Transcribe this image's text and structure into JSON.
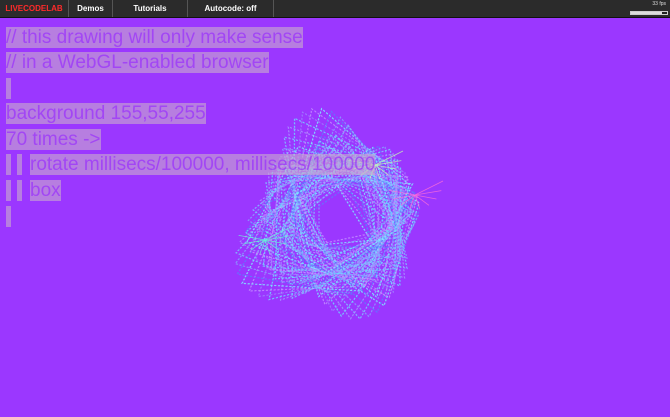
{
  "menu": {
    "logo": "LIVECODELAB",
    "items": [
      {
        "label": "Demos"
      },
      {
        "label": "Tutorials"
      },
      {
        "label": "Autocode: off"
      }
    ],
    "fps": "33 fps",
    "fps_level": 0.85
  },
  "code": {
    "lines": [
      "// this drawing will only make sense",
      "// in a WebGL-enabled browser",
      "",
      "background 155,55,255",
      "70 times ->",
      "rotate millisecs/100000, millisecs/100000",
      "box",
      ""
    ]
  },
  "colors": {
    "background": "#9b37ff",
    "menubar": "#2b2b2b",
    "logo": "#ff2a2a",
    "code_highlight": "rgba(200,170,205,0.62)",
    "code_text": "rgba(150,40,255,0.65)"
  }
}
